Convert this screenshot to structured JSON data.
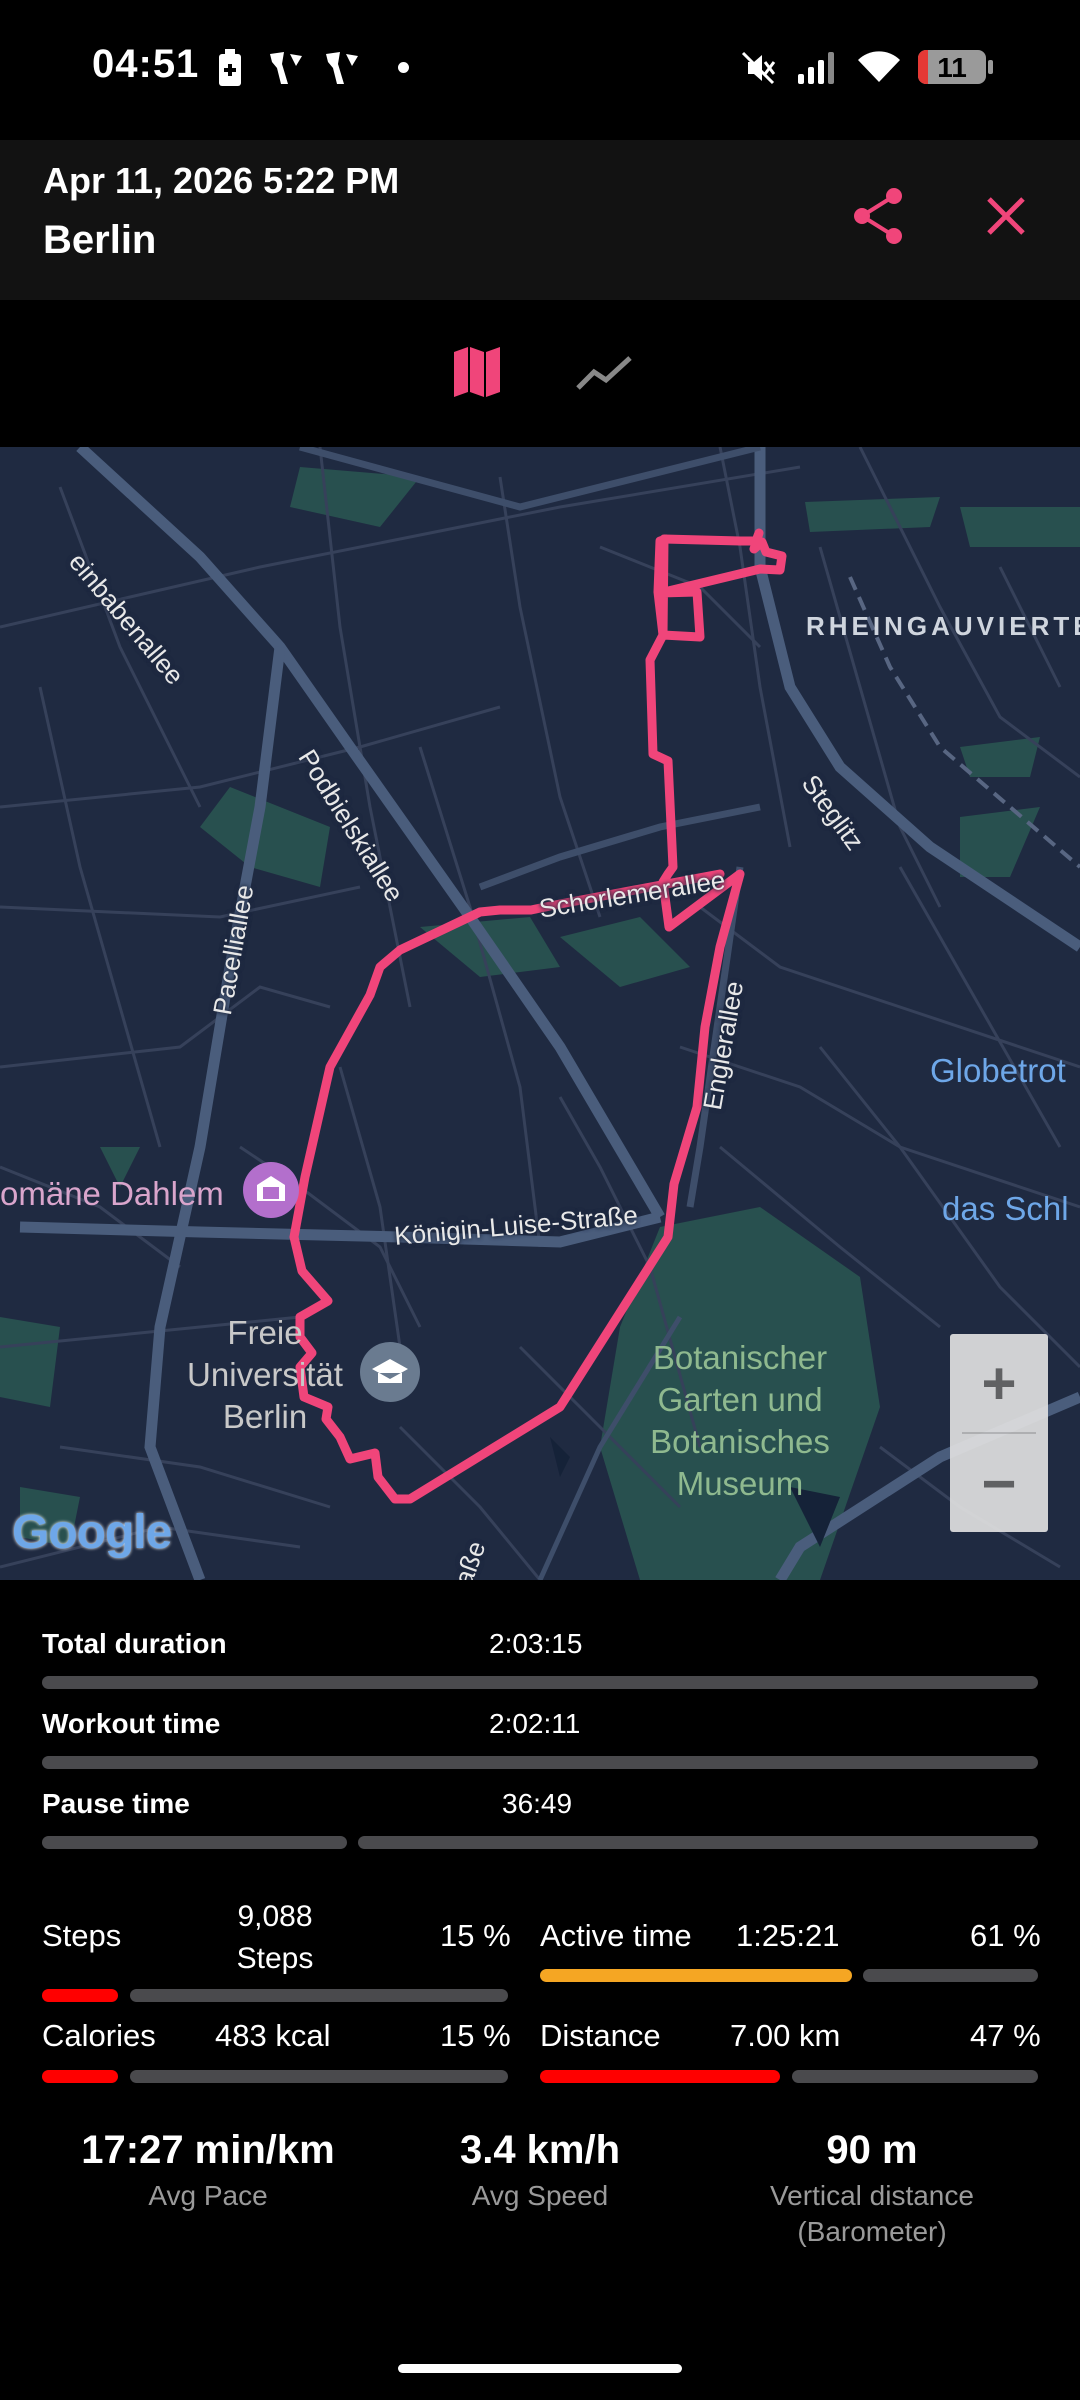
{
  "status_bar": {
    "time": "04:51",
    "battery_level": "11",
    "icons": [
      "battery-saver-icon",
      "running-notification-icon",
      "running-notification-icon",
      "dot-icon",
      "mute-icon",
      "signal-icon",
      "wifi-icon",
      "battery-icon"
    ]
  },
  "header": {
    "date": "Apr 11, 2026 5:22 PM",
    "location": "Berlin",
    "actions": [
      "share-icon",
      "close-icon"
    ],
    "accent_color": "#f0457a"
  },
  "tabs": [
    {
      "icon": "map-icon",
      "selected": true
    },
    {
      "icon": "chart-line-icon",
      "selected": false
    }
  ],
  "map": {
    "streets": [
      "einbabenallee",
      "Podbielskiallee",
      "Schorlemerallee",
      "Pacelliallee",
      "Englerallee",
      "Königin-Luise-Straße",
      "Steglitz",
      "aße"
    ],
    "districts": [
      "RHEINGAUVIERTEL"
    ],
    "places": {
      "domaene": "omäne Dahlem",
      "fu_line1": "Freie",
      "fu_line2": "Universität",
      "fu_line3": "Berlin",
      "garden_line1": "Botanischer",
      "garden_line2": "Garten und",
      "garden_line3": "Botanisches",
      "garden_line4": "Museum",
      "globetrot": "Globetrot",
      "schloss": "das Schl"
    },
    "zoom_in_label": "+",
    "zoom_out_label": "−",
    "attribution": "Google",
    "route_color": "#f0457a"
  },
  "durations": [
    {
      "label": "Total duration",
      "value": "2:03:15",
      "fraction": 1.0
    },
    {
      "label": "Workout time",
      "value": "2:02:11",
      "fraction": 1.0
    },
    {
      "label": "Pause time",
      "value": "36:49",
      "fraction": 0.3
    }
  ],
  "goals": {
    "steps": {
      "label": "Steps",
      "value_line1": "9,088",
      "value_line2": "Steps",
      "percent": "15 %",
      "fraction": 0.15,
      "color": "#ff0000"
    },
    "active_time": {
      "label": "Active time",
      "value": "1:25:21",
      "percent": "61 %",
      "fraction": 0.61,
      "color": "#f5a623"
    },
    "calories": {
      "label": "Calories",
      "value": "483 kcal",
      "percent": "15 %",
      "fraction": 0.15,
      "color": "#ff0000"
    },
    "distance": {
      "label": "Distance",
      "value": "7.00 km",
      "percent": "47 %",
      "fraction": 0.47,
      "color": "#ff0000"
    }
  },
  "summary": [
    {
      "value": "17:27 min/km",
      "label": "Avg Pace"
    },
    {
      "value": "3.4 km/h",
      "label": "Avg Speed"
    },
    {
      "value": "90 m",
      "label_line1": "Vertical distance",
      "label_line2": "(Barometer)"
    }
  ]
}
